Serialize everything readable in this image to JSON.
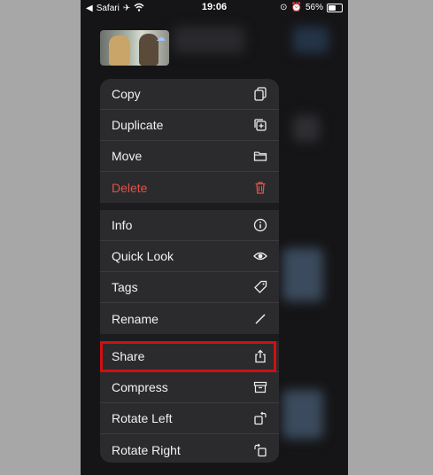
{
  "status_bar": {
    "back_app": "Safari",
    "time": "19:06",
    "battery": "56%",
    "battery_level": 0.56
  },
  "menu": {
    "group1": [
      {
        "label": "Copy",
        "icon": "copy-icon"
      },
      {
        "label": "Duplicate",
        "icon": "duplicate-icon"
      },
      {
        "label": "Move",
        "icon": "folder-icon"
      },
      {
        "label": "Delete",
        "icon": "trash-icon",
        "color": "#e0524a"
      }
    ],
    "group2": [
      {
        "label": "Info",
        "icon": "info-icon"
      },
      {
        "label": "Quick Look",
        "icon": "eye-icon"
      },
      {
        "label": "Tags",
        "icon": "tag-icon"
      },
      {
        "label": "Rename",
        "icon": "pencil-icon"
      }
    ],
    "group3": [
      {
        "label": "Share",
        "icon": "share-icon"
      },
      {
        "label": "Compress",
        "icon": "archive-icon"
      },
      {
        "label": "Rotate Left",
        "icon": "rotate-left-icon"
      },
      {
        "label": "Rotate Right",
        "icon": "rotate-right-icon"
      }
    ]
  },
  "highlight_color": "#d10f0f"
}
